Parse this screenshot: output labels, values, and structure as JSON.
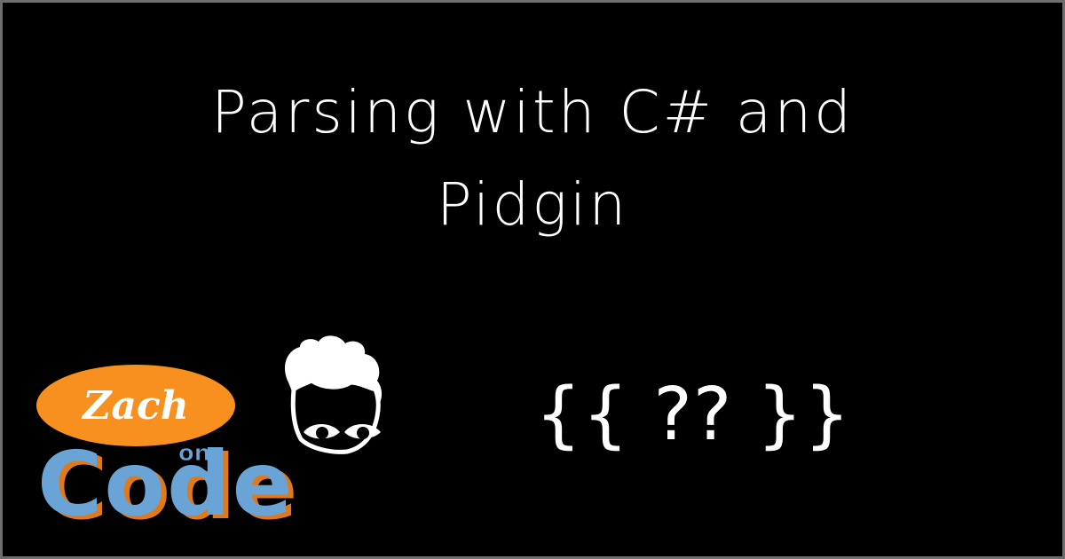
{
  "title": {
    "line1": "Parsing with C# and",
    "line2": "Pidgin"
  },
  "logo": {
    "zach": "Zach",
    "on": "on",
    "code": "Code",
    "colors": {
      "oval": "#f7901e",
      "code_fill": "#6aa3d5",
      "code_shadow": "#e0791a",
      "face": "#ffffff"
    },
    "icon": "cartoon-face-icon"
  },
  "decoration": {
    "text": "{{ ?? }}"
  },
  "colors": {
    "background": "#000000",
    "border": "#6e6e6e",
    "text": "#ffffff"
  }
}
